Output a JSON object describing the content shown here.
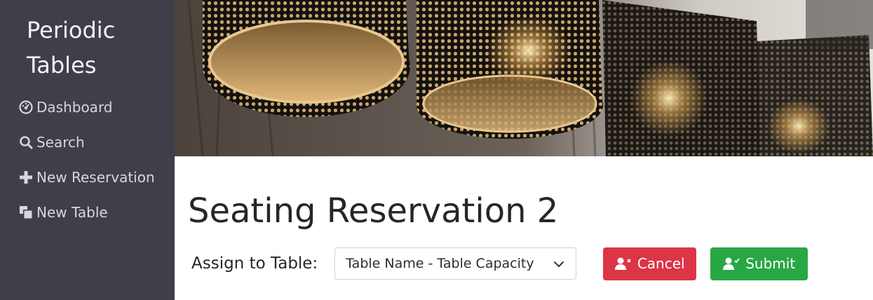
{
  "sidebar": {
    "brand_line1": "Periodic",
    "brand_line2": "Tables",
    "items": [
      {
        "label": "Dashboard",
        "icon": "dashboard-icon"
      },
      {
        "label": "Search",
        "icon": "search-icon"
      },
      {
        "label": "New Reservation",
        "icon": "plus-icon"
      },
      {
        "label": "New Table",
        "icon": "layers-icon"
      }
    ]
  },
  "main": {
    "title": "Seating Reservation 2",
    "assign_label": "Assign to Table:",
    "table_select": {
      "selected": "Table Name - Table Capacity"
    },
    "cancel_label": "Cancel",
    "submit_label": "Submit"
  },
  "colors": {
    "sidebar_bg": "#3e3f49",
    "cancel": "#dc3545",
    "submit": "#28a745"
  }
}
